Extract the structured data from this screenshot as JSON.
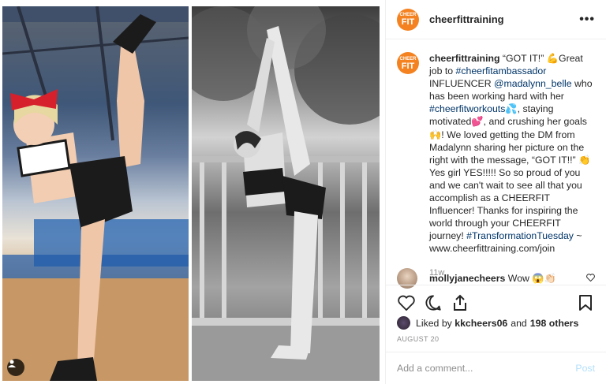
{
  "post": {
    "username": "cheerfittraining",
    "avatar_text_top": "CHEER",
    "avatar_text_bottom": "FIT",
    "more_label": "•••",
    "caption": {
      "username": "cheerfittraining",
      "segments": [
        {
          "text": " “GOT IT!” 💪Great job to ",
          "type": "text"
        },
        {
          "text": "#cheerfitambassador",
          "type": "tag"
        },
        {
          "text": " INFLUENCER ",
          "type": "text"
        },
        {
          "text": "@madalynn_belle",
          "type": "tag"
        },
        {
          "text": " who has been working hard with her ",
          "type": "text"
        },
        {
          "text": "#cheerfitworkouts",
          "type": "tag"
        },
        {
          "text": "💦, staying motivated💕, and crushing her goals 🙌! We loved getting the DM from Madalynn sharing her picture on the right with the message, “GOT IT!!” 👏 Yes girl YES!!!!! So so proud of you and we can't wait to see all that you accomplish as a CHEERFIT Influencer! Thanks for inspiring the world through your CHEERFIT journey! ",
          "type": "text"
        },
        {
          "text": "#TransformationTuesday",
          "type": "tag"
        },
        {
          "text": " ~ www.cheerfittraining.com/join",
          "type": "text"
        }
      ]
    },
    "time_ago": "11w",
    "reply": {
      "username": "mollyjanecheers",
      "text": " Wow 😱👏🏻"
    },
    "likes": {
      "prefix": "Liked by",
      "user": "kkcheers06",
      "mid": "and",
      "others": "198 others"
    },
    "date": "AUGUST 20",
    "comment_input": {
      "placeholder": "Add a comment...",
      "value": ""
    },
    "post_button": "Post"
  },
  "icons": {
    "heart": "heart-icon",
    "comment": "comment-icon",
    "share": "share-icon",
    "bookmark": "bookmark-icon",
    "user_tag": "user-tag-icon"
  },
  "colors": {
    "brand_orange": "#f58220",
    "link": "#003569",
    "muted": "#8e8e8e",
    "post_disabled": "#b2dffc"
  }
}
